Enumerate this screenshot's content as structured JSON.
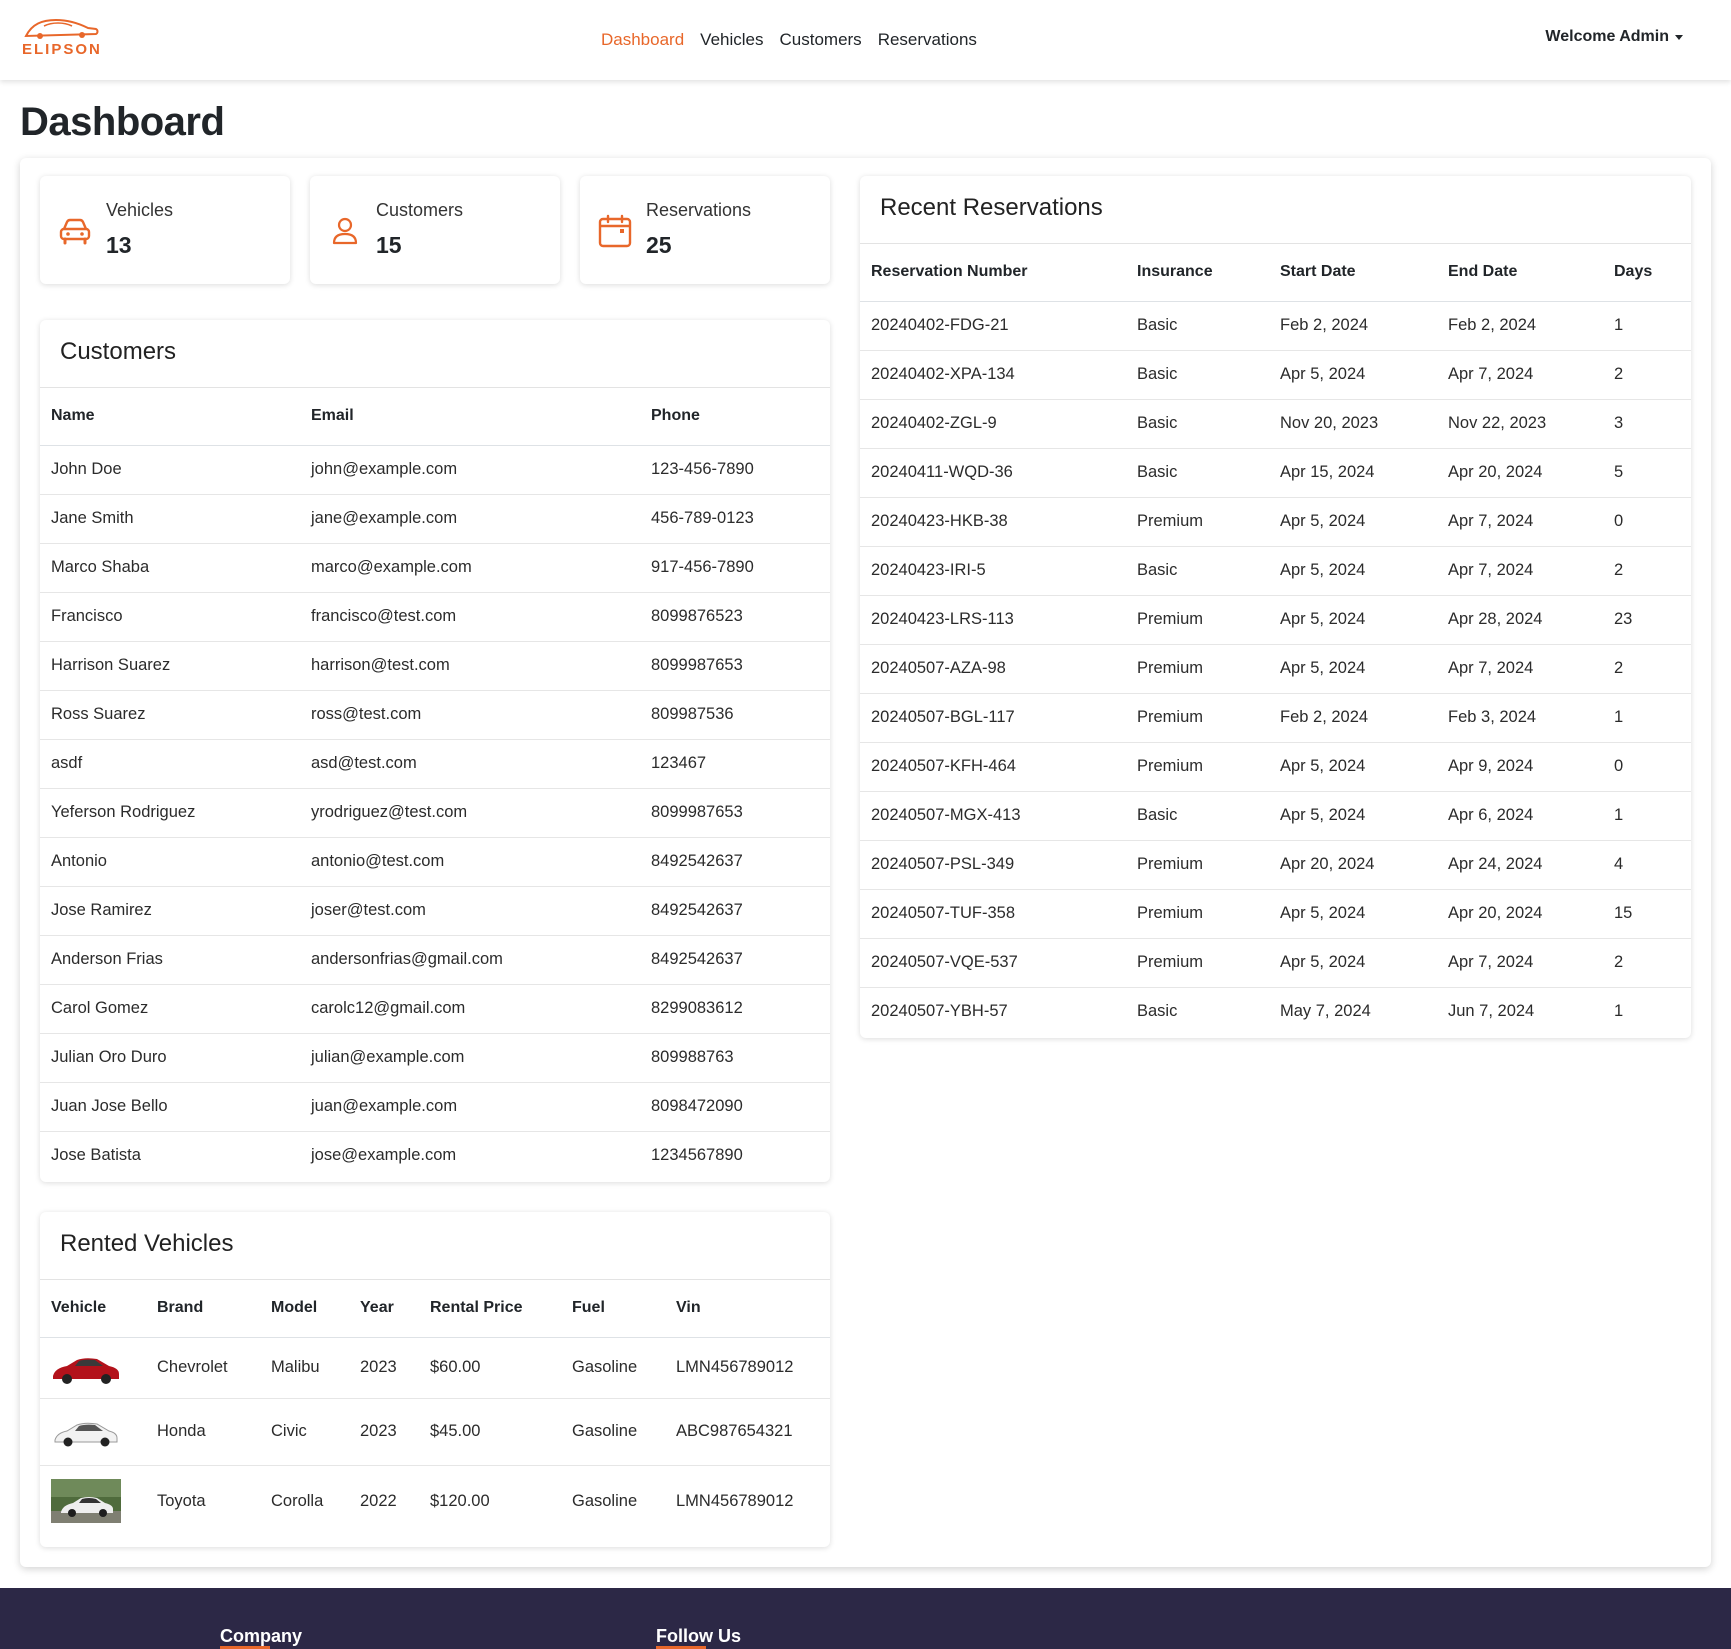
{
  "brand": {
    "name": "ELIPSON",
    "accent_color": "#e8672a"
  },
  "nav": {
    "links": [
      "Dashboard",
      "Vehicles",
      "Customers",
      "Reservations"
    ],
    "active": "Dashboard",
    "user_label": "Welcome Admin"
  },
  "page": {
    "title": "Dashboard"
  },
  "stats": [
    {
      "label": "Vehicles",
      "value": "13",
      "icon": "car-icon"
    },
    {
      "label": "Customers",
      "value": "15",
      "icon": "person-icon"
    },
    {
      "label": "Reservations",
      "value": "25",
      "icon": "calendar-icon"
    }
  ],
  "customers": {
    "title": "Customers",
    "columns": [
      "Name",
      "Email",
      "Phone"
    ],
    "rows": [
      [
        "John Doe",
        "john@example.com",
        "123-456-7890"
      ],
      [
        "Jane Smith",
        "jane@example.com",
        "456-789-0123"
      ],
      [
        "Marco Shaba",
        "marco@example.com",
        "917-456-7890"
      ],
      [
        "Francisco",
        "francisco@test.com",
        "8099876523"
      ],
      [
        "Harrison Suarez",
        "harrison@test.com",
        "8099987653"
      ],
      [
        "Ross Suarez",
        "ross@test.com",
        "809987536"
      ],
      [
        "asdf",
        "asd@test.com",
        "123467"
      ],
      [
        "Yeferson Rodriguez",
        "yrodriguez@test.com",
        "8099987653"
      ],
      [
        "Antonio",
        "antonio@test.com",
        "8492542637"
      ],
      [
        "Jose Ramirez",
        "joser@test.com",
        "8492542637"
      ],
      [
        "Anderson Frias",
        "andersonfrias@gmail.com",
        "8492542637"
      ],
      [
        "Carol Gomez",
        "carolc12@gmail.com",
        "8299083612"
      ],
      [
        "Julian Oro Duro",
        "julian@example.com",
        "809988763"
      ],
      [
        "Juan Jose Bello",
        "juan@example.com",
        "8098472090"
      ],
      [
        "Jose Batista",
        "jose@example.com",
        "1234567890"
      ]
    ]
  },
  "rented_vehicles": {
    "title": "Rented Vehicles",
    "columns": [
      "Vehicle",
      "Brand",
      "Model",
      "Year",
      "Rental Price",
      "Fuel",
      "Vin"
    ],
    "rows": [
      {
        "thumb": "red-sedan",
        "brand": "Chevrolet",
        "model": "Malibu",
        "year": "2023",
        "price": "$60.00",
        "fuel": "Gasoline",
        "vin": "LMN456789012"
      },
      {
        "thumb": "white-sedan",
        "brand": "Honda",
        "model": "Civic",
        "year": "2023",
        "price": "$45.00",
        "fuel": "Gasoline",
        "vin": "ABC987654321"
      },
      {
        "thumb": "white-sedan-photo",
        "brand": "Toyota",
        "model": "Corolla",
        "year": "2022",
        "price": "$120.00",
        "fuel": "Gasoline",
        "vin": "LMN456789012"
      }
    ]
  },
  "reservations": {
    "title": "Recent Reservations",
    "columns": [
      "Reservation Number",
      "Insurance",
      "Start Date",
      "End Date",
      "Days"
    ],
    "rows": [
      [
        "20240402-FDG-21",
        "Basic",
        "Feb 2, 2024",
        "Feb 2, 2024",
        "1"
      ],
      [
        "20240402-XPA-134",
        "Basic",
        "Apr 5, 2024",
        "Apr 7, 2024",
        "2"
      ],
      [
        "20240402-ZGL-9",
        "Basic",
        "Nov 20, 2023",
        "Nov 22, 2023",
        "3"
      ],
      [
        "20240411-WQD-36",
        "Basic",
        "Apr 15, 2024",
        "Apr 20, 2024",
        "5"
      ],
      [
        "20240423-HKB-38",
        "Premium",
        "Apr 5, 2024",
        "Apr 7, 2024",
        "0"
      ],
      [
        "20240423-IRI-5",
        "Basic",
        "Apr 5, 2024",
        "Apr 7, 2024",
        "2"
      ],
      [
        "20240423-LRS-113",
        "Premium",
        "Apr 5, 2024",
        "Apr 28, 2024",
        "23"
      ],
      [
        "20240507-AZA-98",
        "Premium",
        "Apr 5, 2024",
        "Apr 7, 2024",
        "2"
      ],
      [
        "20240507-BGL-117",
        "Premium",
        "Feb 2, 2024",
        "Feb 3, 2024",
        "1"
      ],
      [
        "20240507-KFH-464",
        "Premium",
        "Apr 5, 2024",
        "Apr 9, 2024",
        "0"
      ],
      [
        "20240507-MGX-413",
        "Basic",
        "Apr 5, 2024",
        "Apr 6, 2024",
        "1"
      ],
      [
        "20240507-PSL-349",
        "Premium",
        "Apr 20, 2024",
        "Apr 24, 2024",
        "4"
      ],
      [
        "20240507-TUF-358",
        "Premium",
        "Apr 5, 2024",
        "Apr 20, 2024",
        "15"
      ],
      [
        "20240507-VQE-537",
        "Premium",
        "Apr 5, 2024",
        "Apr 7, 2024",
        "2"
      ],
      [
        "20240507-YBH-57",
        "Basic",
        "May 7, 2024",
        "Jun 7, 2024",
        "1"
      ]
    ]
  },
  "footer": {
    "headings": [
      "Company",
      "Follow Us"
    ],
    "background": "#2c2846"
  }
}
